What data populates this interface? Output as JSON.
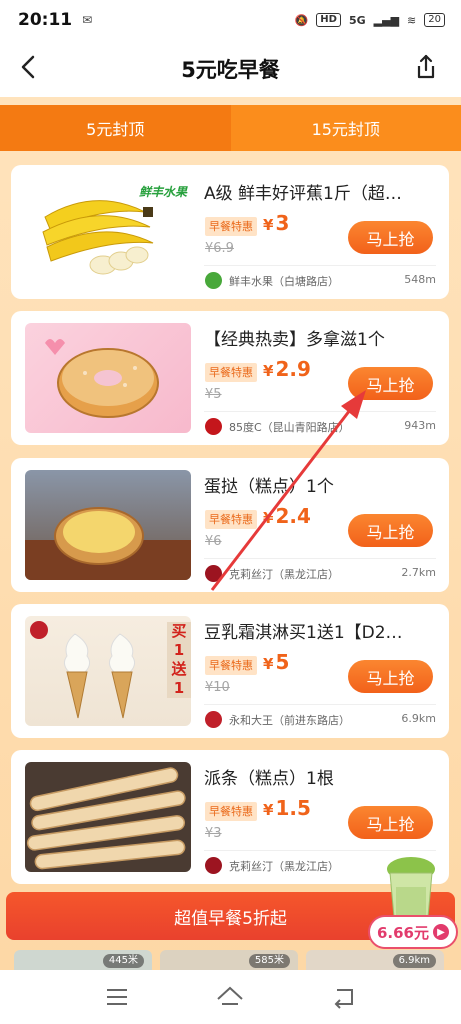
{
  "status": {
    "time": "20:11",
    "left_icon": "sms-icon",
    "hd": "HD",
    "net": "5G",
    "battery": "20"
  },
  "nav": {
    "title": "5元吃早餐",
    "back_icon": "chevron-left-icon",
    "share_icon": "share-icon"
  },
  "tabs": [
    {
      "label": "5元封顶"
    },
    {
      "label": "15元封顶"
    }
  ],
  "products": [
    {
      "name": "A级 鲜丰好评蕉1斤（超…",
      "tag": "早餐特惠",
      "price": "3",
      "orig": "¥6.9",
      "button": "马上抢",
      "store": "鲜丰水果（白塘路店）",
      "distance": "548m",
      "brand": "鲜丰水果"
    },
    {
      "name": "【经典热卖】多拿滋1个",
      "tag": "早餐特惠",
      "price": "2.9",
      "orig": "¥5",
      "button": "马上抢",
      "store": "85度C（昆山青阳路店）",
      "distance": "943m"
    },
    {
      "name": "蛋挞（糕点）1个",
      "tag": "早餐特惠",
      "price": "2.4",
      "orig": "¥6",
      "button": "马上抢",
      "store": "克莉丝汀（黑龙江店）",
      "distance": "2.7km"
    },
    {
      "name": "豆乳霜淇淋买1送1【D2…",
      "tag": "早餐特惠",
      "price": "5",
      "orig": "¥10",
      "button": "马上抢",
      "store": "永和大王（前进东路店）",
      "distance": "6.9km",
      "promo": "买1送1"
    },
    {
      "name": "派条（糕点）1根",
      "tag": "早餐特惠",
      "price": "1.5",
      "orig": "¥3",
      "button": "马上抢",
      "store": "克莉丝汀（黑龙江店）",
      "distance": ""
    }
  ],
  "yen": "¥",
  "bottom_banner": "超值早餐5折起",
  "red_packet": {
    "amount": "6.66元"
  },
  "thumb_badges": [
    "445米",
    "585米",
    "6.9km"
  ],
  "colors": {
    "accent": "#f47a12",
    "price": "#f0631a",
    "banner": "#e9412d",
    "redpacket": "#e23b6c"
  }
}
